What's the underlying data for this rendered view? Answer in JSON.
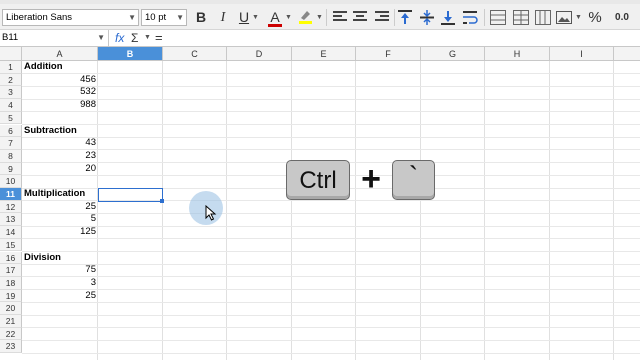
{
  "toolbar": {
    "font_name": "Liberation Sans",
    "font_size": "10 pt",
    "bold": "B",
    "italic": "I",
    "underline": "U",
    "font_color": "A",
    "percent": "%",
    "decimal": "0.0"
  },
  "formula_bar": {
    "cell_ref": "B11",
    "fx": "fx",
    "sum": "Σ",
    "equals": "="
  },
  "columns": [
    "A",
    "B",
    "C",
    "D",
    "E",
    "F",
    "G",
    "H",
    "I"
  ],
  "rows": [
    "1",
    "2",
    "3",
    "4",
    "5",
    "6",
    "7",
    "8",
    "9",
    "10",
    "11",
    "12",
    "13",
    "14",
    "15",
    "16",
    "17",
    "18",
    "19",
    "20",
    "21",
    "22",
    "23"
  ],
  "sections": {
    "addition": "Addition",
    "subtraction": "Subtraction",
    "multiplication": "Multiplication",
    "division": "Division"
  },
  "values": {
    "r2": "456",
    "r3": "532",
    "r4": "988",
    "r7": "43",
    "r8": "23",
    "r9": "20",
    "r12": "25",
    "r13": "5",
    "r14": "125",
    "r17": "75",
    "r18": "3",
    "r19": "25"
  },
  "shortcut": {
    "key1": "Ctrl",
    "plus": "+",
    "key2": "`"
  },
  "colors": {
    "selection_blue": "#2d6fcf",
    "header_selected": "#4a90d9",
    "font_color_red": "#cc0000",
    "highlight_yellow": "#ffff00"
  }
}
